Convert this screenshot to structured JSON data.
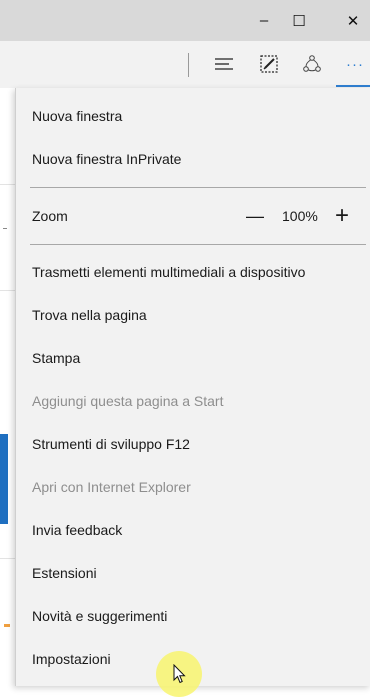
{
  "window": {
    "minimize_icon": "minimize-icon",
    "maximize_icon": "maximize-icon",
    "close_icon": "close-icon",
    "minimize_glyph": "–",
    "maximize_glyph": "☐",
    "close_glyph": "✕"
  },
  "toolbar": {
    "icons": [
      "hub-icon",
      "web-note-icon",
      "share-icon",
      "more-icon"
    ],
    "more_glyph": "···",
    "accent": "#2f7fd1"
  },
  "menu": {
    "items": [
      {
        "label": "Nuova finestra",
        "enabled": true
      },
      {
        "label": "Nuova finestra InPrivate",
        "enabled": true
      },
      {
        "label": "Trasmetti elementi multimediali a dispositivo",
        "enabled": true
      },
      {
        "label": "Trova nella pagina",
        "enabled": true
      },
      {
        "label": "Stampa",
        "enabled": true
      },
      {
        "label": "Aggiungi questa pagina a Start",
        "enabled": false
      },
      {
        "label": "Strumenti di sviluppo F12",
        "enabled": true
      },
      {
        "label": "Apri con Internet Explorer",
        "enabled": false
      },
      {
        "label": "Invia feedback",
        "enabled": true
      },
      {
        "label": "Estensioni",
        "enabled": true
      },
      {
        "label": "Novità e suggerimenti",
        "enabled": true
      },
      {
        "label": "Impostazioni",
        "enabled": true
      }
    ],
    "zoom": {
      "label": "Zoom",
      "minus": "—",
      "value": "100%",
      "plus": "+"
    }
  },
  "colors": {
    "menu_bg": "#f2f2f2",
    "disabled_text": "#8e8e8e",
    "highlight": "#f8f46e"
  }
}
